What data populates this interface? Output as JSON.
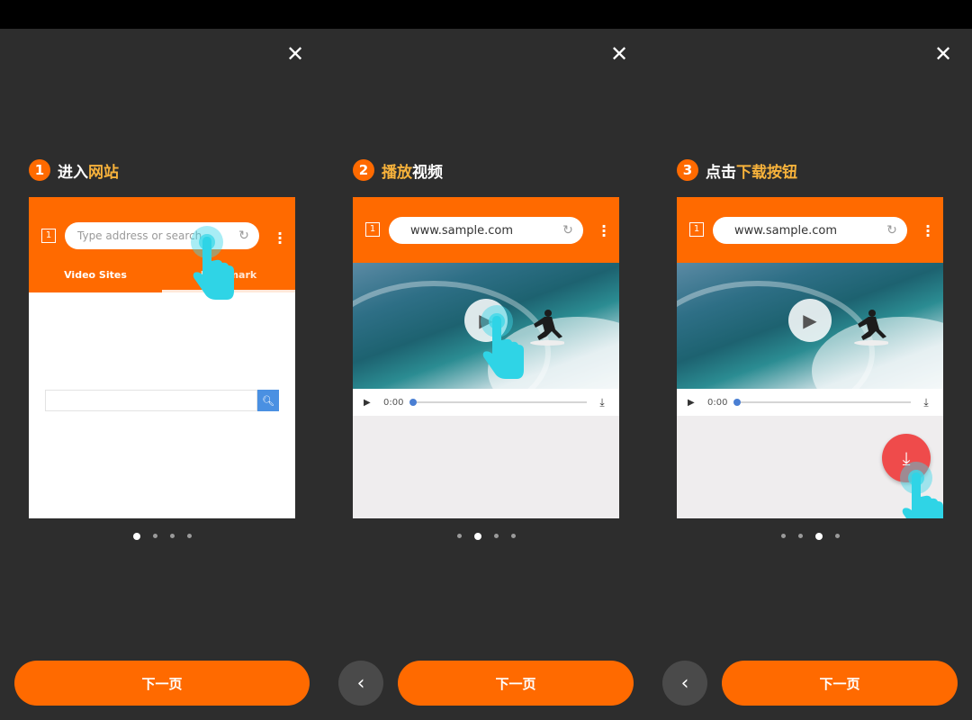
{
  "close_glyph": "✕",
  "accent": "#ff6a00",
  "highlight": "#f7b23b",
  "panels": [
    {
      "step_number": "1",
      "step_plain": "进入",
      "step_highlight": "网站",
      "tab_number": "1",
      "address_placeholder": "Type address or search",
      "tabs": [
        "Video Sites",
        "Bookmark"
      ],
      "page_index": 0,
      "next_label": "下一页"
    },
    {
      "step_number": "2",
      "step_highlight": "播放",
      "step_plain": "视频",
      "tab_number": "1",
      "address": "www.sample.com",
      "time": "0:00",
      "page_index": 1,
      "next_label": "下一页",
      "back_glyph": "‹"
    },
    {
      "step_number": "3",
      "step_plain": "点击",
      "step_highlight": "下载按钮",
      "tab_number": "1",
      "address": "www.sample.com",
      "time": "0:00",
      "page_index": 2,
      "next_label": "下一页",
      "back_glyph": "‹"
    }
  ],
  "page_count": 4
}
